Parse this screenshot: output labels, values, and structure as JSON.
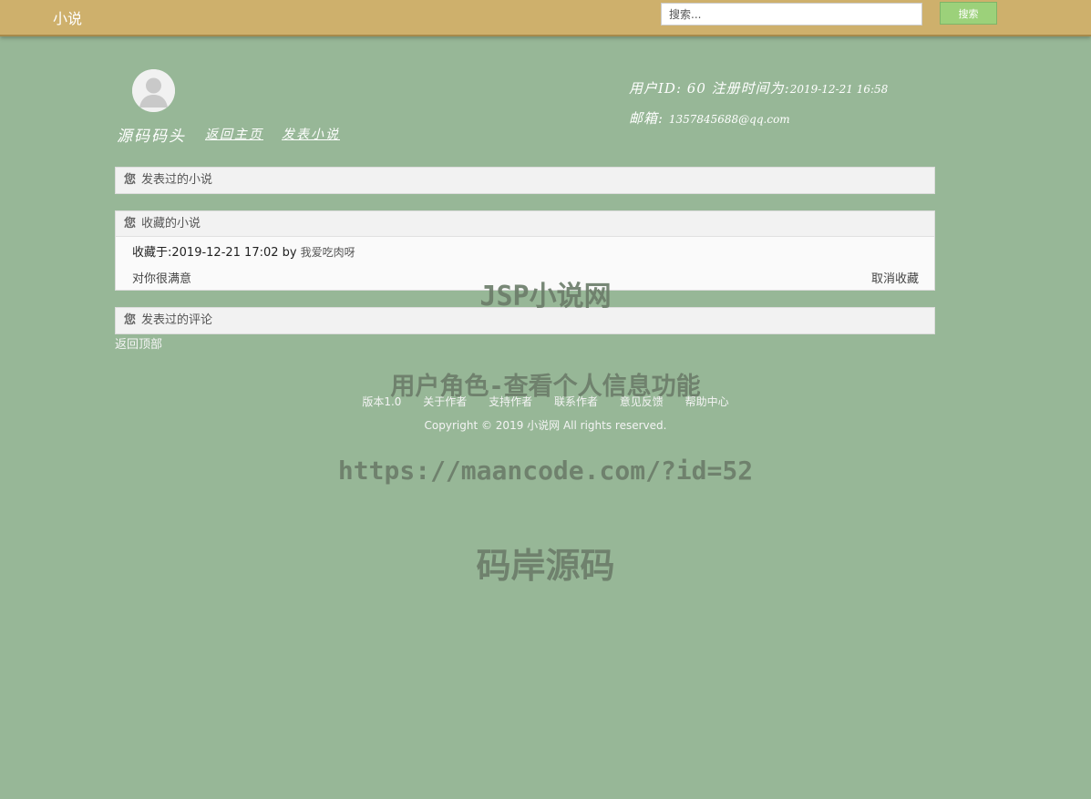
{
  "navbar": {
    "brand": "小说",
    "search_placeholder": "搜索...",
    "search_button": "搜索"
  },
  "profile": {
    "username": "源码码头",
    "home_link": "返回主页",
    "publish_link": "发表小说",
    "user_id_line": "用户ID: 60   注册时间为:",
    "register_time": "2019-12-21 16:58",
    "email_label": "邮箱: ",
    "email": "1357845688@qq.com"
  },
  "panels": {
    "published_novels": {
      "prefix": "您",
      "title": "发表过的小说"
    },
    "favorites": {
      "prefix": "您",
      "title": "收藏的小说",
      "items": [
        {
          "collected_at": "收藏于:2019-12-21 17:02  by",
          "author": "我爱吃肉呀",
          "comment": "对你很满意",
          "unfavorite": "取消收藏"
        }
      ]
    },
    "comments": {
      "prefix": "您",
      "title": "发表过的评论"
    }
  },
  "back_to_top": "返回顶部",
  "footer": {
    "links": [
      "版本1.0",
      "关于作者",
      "支持作者",
      "联系作者",
      "意见反馈",
      "帮助中心"
    ],
    "copyright": "Copyright © 2019 小说网 All rights reserved."
  },
  "watermarks": {
    "line1": "JSP小说网",
    "line2": "用户角色-查看个人信息功能",
    "line3": "https://maancode.com/?id=52",
    "line4": "码岸源码"
  },
  "colors": {
    "page_background": "#97b797",
    "navbar": "#ceb06c",
    "search_button": "#9cd17a"
  }
}
